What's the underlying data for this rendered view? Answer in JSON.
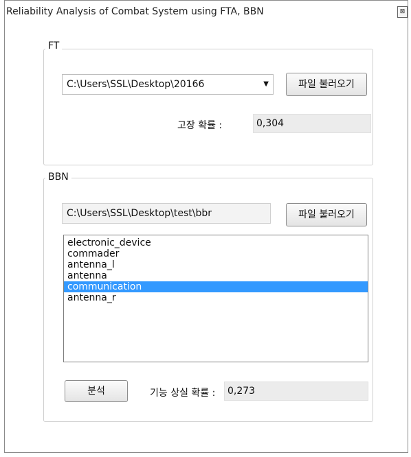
{
  "window": {
    "title": "Reliability Analysis of Combat System using FTA, BBN",
    "close_glyph": "⊠"
  },
  "ft": {
    "group_label": "FT",
    "path_value": "C:\\Users\\SSL\\Desktop\\20166",
    "load_button": "파일 불러오기",
    "failure_label": "고장 확률 :",
    "failure_value": "0,304"
  },
  "bbn": {
    "group_label": "BBN",
    "path_value": "C:\\Users\\SSL\\Desktop\\test\\bbr",
    "load_button": "파일 불러오기",
    "items": [
      {
        "label": "electronic_device"
      },
      {
        "label": "commader"
      },
      {
        "label": "antenna_l"
      },
      {
        "label": "antenna"
      },
      {
        "label": "communication",
        "selected": true
      },
      {
        "label": "antenna_r"
      }
    ],
    "analyze_button": "분석",
    "loss_label": "기능 상실 확률 :",
    "loss_value": "0,273"
  },
  "colors": {
    "selection": "#3399ff",
    "readout_bg": "#ececec"
  }
}
